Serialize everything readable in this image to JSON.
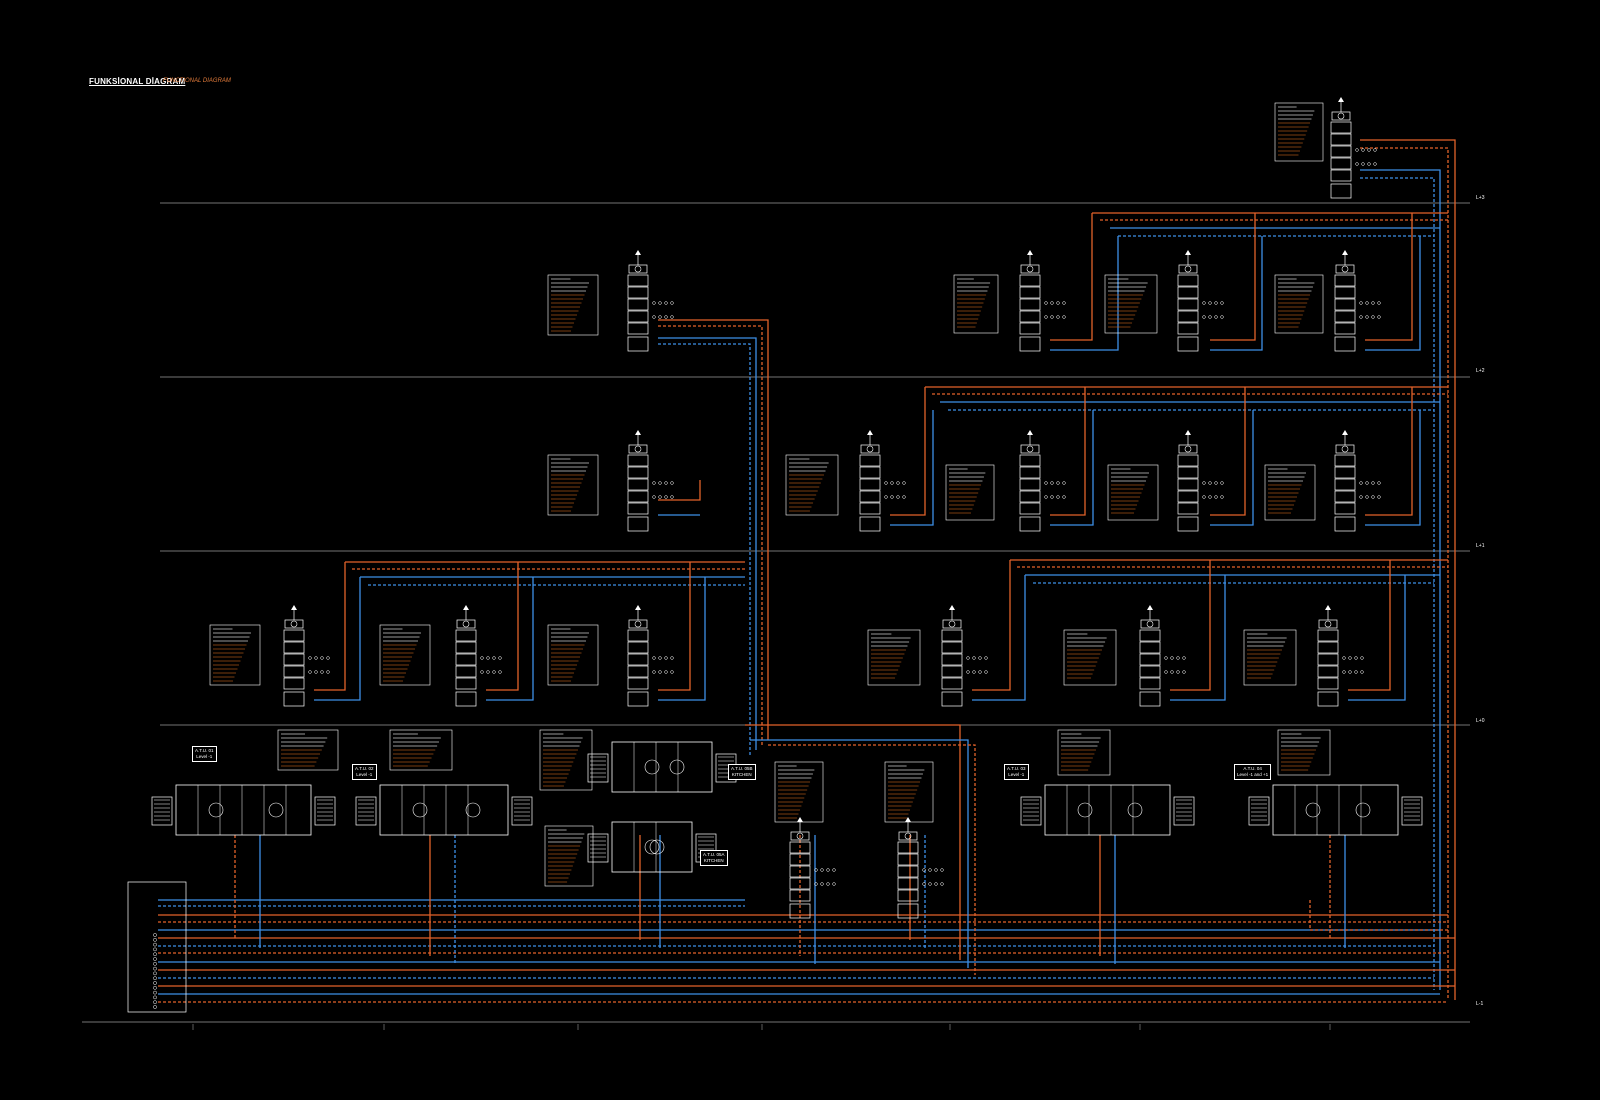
{
  "diagram": {
    "title": "FUNKSİONAL DİAGRAM",
    "subtitle": "FUNCTIONAL DIAGRAM",
    "levels": [
      "L+3",
      "L+2",
      "L+1",
      "L+0",
      "L-1"
    ],
    "ahu_tags": [
      {
        "line1": "A.T.U. 01",
        "line2": "Level -1"
      },
      {
        "line1": "A.T.U. 02",
        "line2": "Level -1"
      },
      {
        "line1": "A.T.U. 05B",
        "line2": "KITCHEN"
      },
      {
        "line1": "A.T.U. 05A",
        "line2": "KITCHEN"
      },
      {
        "line1": "A.T.U. 03",
        "line2": "Level -1"
      },
      {
        "line1": "A.T.U. 04",
        "line2": "Level -1 and +1"
      }
    ]
  },
  "colors": {
    "background": "#000000",
    "hot_water": "#e2622a",
    "chilled_water": "#3d8fe6",
    "equipment": "#ffffff",
    "annotation": "#c8641e",
    "level_line": "#9a9a9a"
  }
}
